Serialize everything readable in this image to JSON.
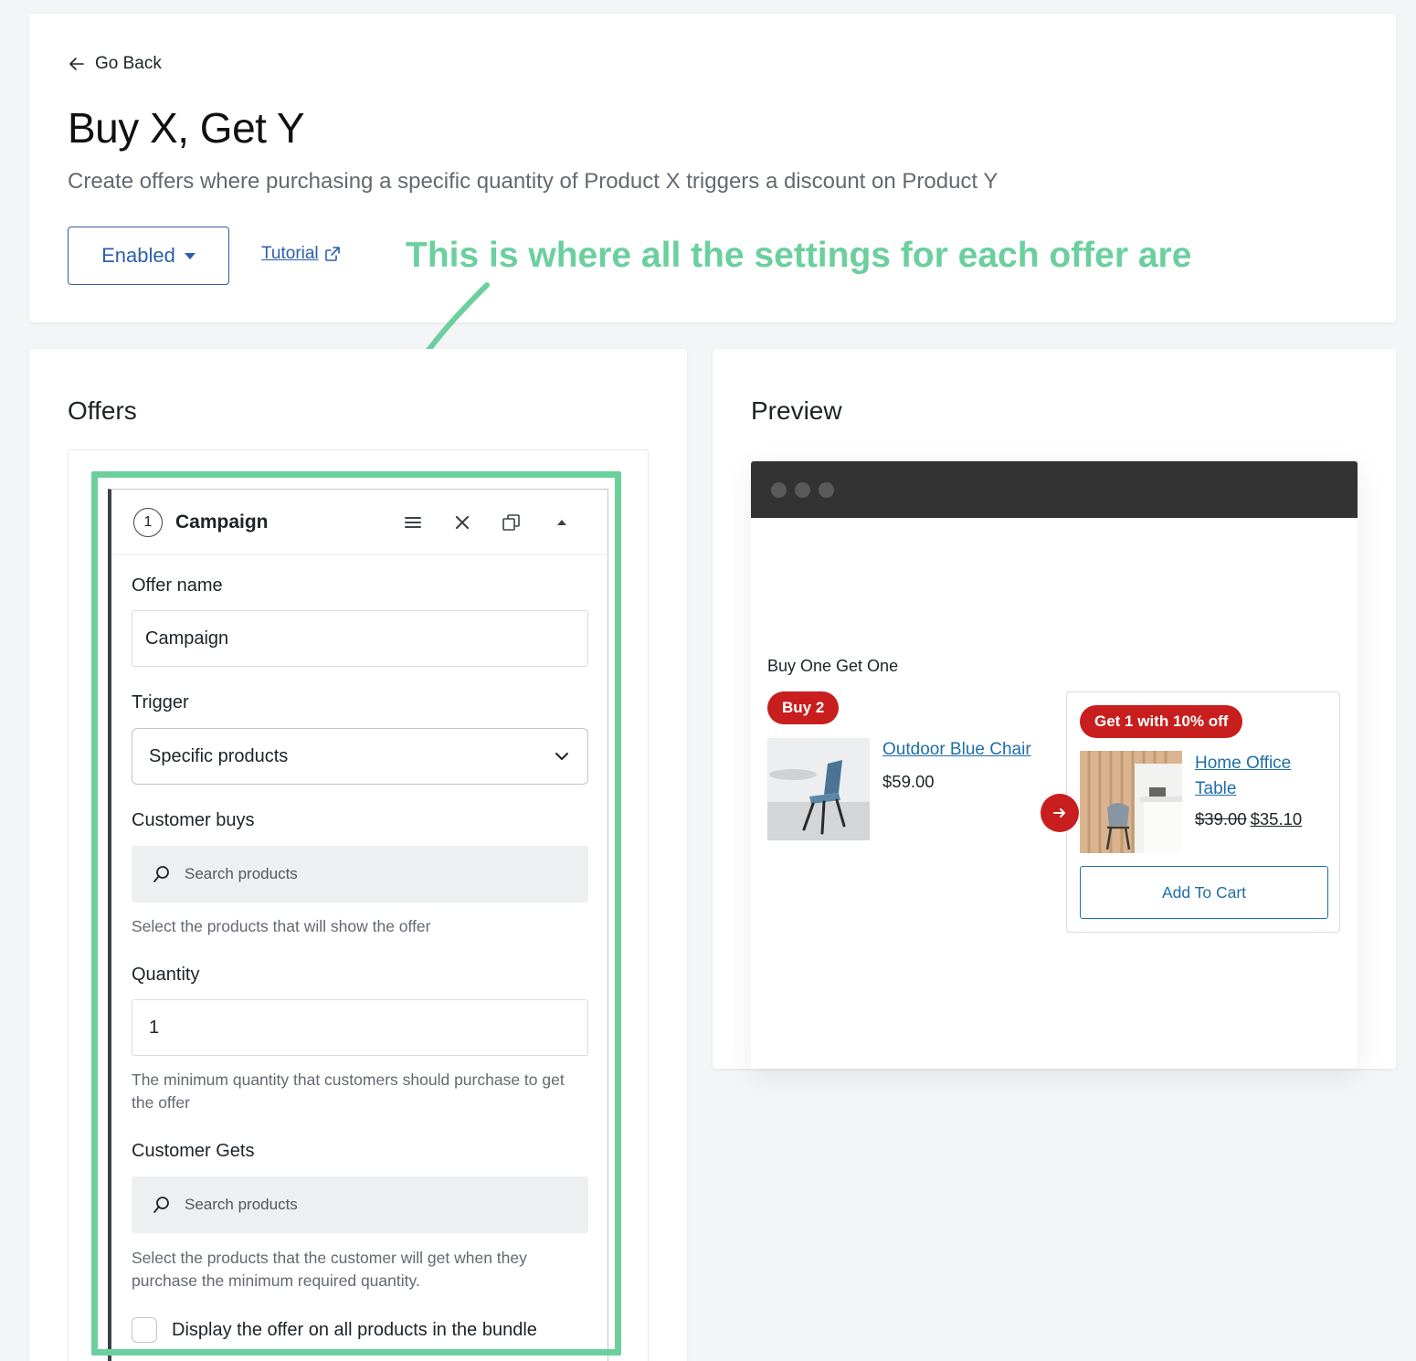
{
  "header": {
    "back_label": "Go Back",
    "title": "Buy X, Get Y",
    "description": "Create offers where purchasing a specific quantity of Product X triggers a discount on Product Y",
    "status_label": "Enabled",
    "tutorial_label": "Tutorial"
  },
  "annotation": {
    "text": "This is where all the settings for each offer are",
    "color": "#6bcf9e"
  },
  "offers": {
    "section_title": "Offers",
    "offer": {
      "number": "1",
      "title": "Campaign",
      "icons": [
        "menu-icon",
        "close-icon",
        "duplicate-icon",
        "collapse-icon"
      ],
      "offer_name_label": "Offer name",
      "offer_name_value": "Campaign",
      "trigger_label": "Trigger",
      "trigger_value": "Specific products",
      "customer_buys_label": "Customer buys",
      "customer_buys_placeholder": "Search products",
      "customer_buys_help": "Select the products that will show the offer",
      "quantity_label": "Quantity",
      "quantity_value": "1",
      "quantity_help": "The minimum quantity that customers should purchase to get the offer",
      "customer_gets_label": "Customer Gets",
      "customer_gets_placeholder": "Search products",
      "customer_gets_help": "Select the products that the customer will get when they purchase the minimum required quantity.",
      "display_all_label": "Display the offer on all products in the bundle"
    }
  },
  "preview": {
    "section_title": "Preview",
    "bogo_title": "Buy One Get One",
    "buy_badge": "Buy 2",
    "buy_product": {
      "name": "Outdoor Blue Chair",
      "price": "$59.00"
    },
    "get_badge": "Get 1 with 10% off",
    "get_product": {
      "name_line1": "Home Office",
      "name_line2": "Table",
      "old_price": "$39.00",
      "new_price": "$35.10"
    },
    "add_to_cart_label": "Add To Cart"
  },
  "colors": {
    "accent_blue": "#2c5fa8",
    "link_blue": "#1f6fa6",
    "badge_red": "#c81e1e",
    "highlight_green": "#6bcf9e"
  }
}
